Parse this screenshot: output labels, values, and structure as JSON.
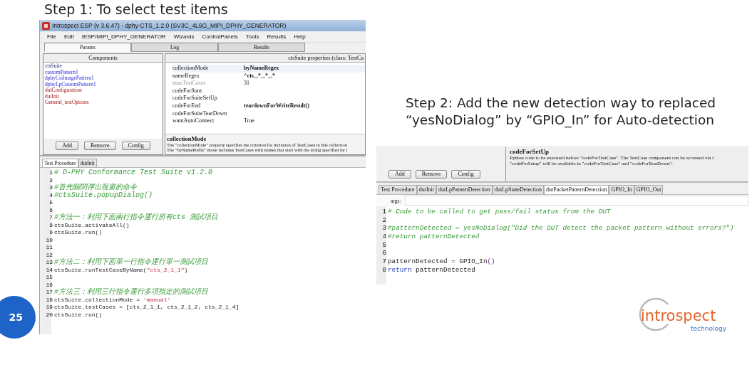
{
  "step1": {
    "title": "Step 1: To select test items"
  },
  "step2": {
    "lines": [
      "Step 2: Add the new detection way to replaced",
      "“yesNoDialog” by “GPIO_In” for Auto-detection"
    ]
  },
  "left_window": {
    "title": "Introspect ESP (v 3.6.47) - dphy-CTS_1.2.0 (SV3C_4L6G_MIPI_DPHY_GENERATOR)",
    "menu": [
      "File",
      "Edit",
      "IESP/MIPI_DPHY_GENERATOR",
      "Wizards",
      "ControlPanels",
      "Tools",
      "Results",
      "Help"
    ],
    "tabs": [
      {
        "label": "Params",
        "selected": true
      },
      {
        "label": "Log",
        "selected": false
      },
      {
        "label": "Results",
        "selected": false
      }
    ],
    "components": {
      "header": "Components",
      "items": [
        {
          "label": "ctsSuite",
          "kind": "suite"
        },
        {
          "label": "customPattern1",
          "kind": "pattern"
        },
        {
          "label": "dphyCsiImagePattern1",
          "kind": "pattern"
        },
        {
          "label": "dphyLpCustomPattern1",
          "kind": "pattern"
        },
        {
          "label": "dutConfiguration",
          "kind": "config"
        },
        {
          "label": "dutInit",
          "kind": "config"
        },
        {
          "label": "General_testOptions",
          "kind": "config"
        }
      ],
      "buttons": [
        "Add",
        "Remove",
        "Config"
      ]
    },
    "properties": {
      "header": "ctsSuite properties (class: TestCa",
      "rows": [
        {
          "name": "collectionMode",
          "value": "byNameRegex",
          "bold": true,
          "disabled": false,
          "selected": true
        },
        {
          "name": "nameRegex",
          "value": "^cts_.*_.*_.*",
          "bold": true,
          "disabled": false,
          "selected": false
        },
        {
          "name": "numTestCases",
          "value": "31",
          "bold": false,
          "disabled": true,
          "selected": false
        },
        {
          "name": "codeForStart",
          "disabled": false,
          "selected": false
        },
        {
          "name": "codeForSuiteSetUp",
          "disabled": false,
          "selected": false
        },
        {
          "name": "codeForEnd",
          "value": "teardownForWriteResult()",
          "bold": true,
          "disabled": false,
          "selected": false
        },
        {
          "name": "codeForSuiteTearDown",
          "disabled": false,
          "selected": false
        },
        {
          "name": "wantAutoConnect",
          "value": "True",
          "bold": false,
          "disabled": false,
          "selected": false
        }
      ],
      "description": {
        "title": "collectionMode",
        "lines": [
          "The \"collectionMode\" property specifies the criterion for inclusion of TestCases in this collection",
          "The \"byNamePrefix\" mode includes TestCases with names that start with the string specified by t"
        ]
      }
    },
    "code_tabs": [
      {
        "label": "Test Procedure",
        "selected": true
      },
      {
        "label": "dutInit",
        "selected": false
      }
    ],
    "code": [
      {
        "number": "1",
        "segments": [
          {
            "kind": "comment",
            "text": "# D-PHY Conformance Test Suite v1.2.0"
          }
        ]
      },
      {
        "number": "2"
      },
      {
        "number": "3",
        "segments": [
          {
            "kind": "comment",
            "text": "#首先關閉彈出視窗的命令"
          }
        ]
      },
      {
        "number": "4",
        "segments": [
          {
            "kind": "comment",
            "text": "#ctsSuite.popupDialog()"
          }
        ]
      },
      {
        "number": "5"
      },
      {
        "number": "6"
      },
      {
        "number": "7",
        "segments": [
          {
            "kind": "comment",
            "text": "#方法一：利用下面兩行指令運行所有cts 測試項目"
          }
        ]
      },
      {
        "number": "8",
        "segments": [
          {
            "kind": "code",
            "text": "ctsSuite.activateAll()"
          }
        ]
      },
      {
        "number": "9",
        "segments": [
          {
            "kind": "code",
            "text": "ctsSuite.run()"
          }
        ]
      },
      {
        "number": "10"
      },
      {
        "number": "11"
      },
      {
        "number": "12"
      },
      {
        "number": "13",
        "segments": [
          {
            "kind": "comment",
            "text": "#方法二：利用下面單一行指令運行單一測試項目"
          }
        ]
      },
      {
        "number": "14",
        "segments": [
          {
            "kind": "code",
            "text": "ctsSuite.runTestCaseByName("
          },
          {
            "kind": "string",
            "text": "\"cts_2_1_1\""
          },
          {
            "kind": "code",
            "text": ")"
          }
        ]
      },
      {
        "number": "15"
      },
      {
        "number": "16"
      },
      {
        "number": "17",
        "segments": [
          {
            "kind": "comment",
            "text": "#方法三：利用三行指令運行多項指定的測試項目"
          }
        ]
      },
      {
        "number": "18",
        "segments": [
          {
            "kind": "code",
            "text": "ctsSuite.collectionMode = "
          },
          {
            "kind": "string",
            "text": "'manual'"
          }
        ]
      },
      {
        "number": "19",
        "segments": [
          {
            "kind": "code",
            "text": "ctsSuite.testCases = [cts_2_1_1, cts_2_1_2, cts_2_1_4]"
          }
        ]
      },
      {
        "number": "20",
        "segments": [
          {
            "kind": "code",
            "text": "ctsSuite.run()"
          }
        ]
      }
    ]
  },
  "right_window": {
    "buttons": [
      "Add",
      "Remove",
      "Config"
    ],
    "description": {
      "title": "codeForSetUp",
      "lines": [
        "Python code to be executed before \"codeForTestCase\". The TestCase component can be accessed via t",
        "\"codeForSetup\" will be available in \"codeForTestCase\" and \"codeForTearDown\"."
      ]
    },
    "tabs": [
      {
        "label": "Test Procedure",
        "selected": false
      },
      {
        "label": "dutInit",
        "selected": false
      },
      {
        "label": "dutLpPatternDetection",
        "selected": false
      },
      {
        "label": "dutLpStateDetection",
        "selected": false
      },
      {
        "label": "dutPacketPatternDetection",
        "selected": true
      },
      {
        "label": "GPIO_In",
        "selected": false
      },
      {
        "label": "GPIO_Out",
        "selected": false
      }
    ],
    "args_label": "args:",
    "code": [
      {
        "number": "1",
        "segments": [
          {
            "kind": "comment",
            "text": "# Code to be called to get pass/fail status from the DUT"
          }
        ]
      },
      {
        "number": "2"
      },
      {
        "number": "3",
        "segments": [
          {
            "kind": "comment",
            "text": "#patternDetected = yesNoDialog(\"Did the DUT detect the packet pattern without errors?\")"
          }
        ]
      },
      {
        "number": "4",
        "segments": [
          {
            "kind": "comment",
            "text": "#return patternDetected"
          }
        ]
      },
      {
        "number": "5"
      },
      {
        "number": "6"
      },
      {
        "number": "7",
        "segments": [
          {
            "kind": "code",
            "text": "patternDetected = GPIO_In"
          },
          {
            "kind": "paren",
            "text": "()"
          }
        ]
      },
      {
        "number": "8",
        "segments": [
          {
            "kind": "keyword",
            "text": "return"
          },
          {
            "kind": "code",
            "text": " patternDetected"
          }
        ]
      }
    ]
  },
  "page_number": "25",
  "logo": {
    "name": "introspect",
    "tagline": "technology"
  }
}
